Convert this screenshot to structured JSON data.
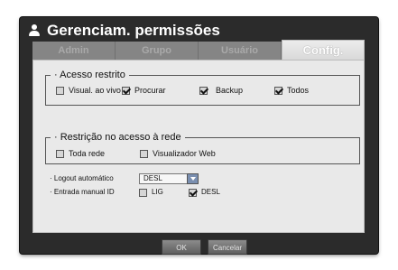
{
  "window": {
    "title": "Gerenciam. permissões"
  },
  "tabs": [
    {
      "label": "Admin",
      "active": false
    },
    {
      "label": "Grupo",
      "active": false
    },
    {
      "label": "Usuário",
      "active": false
    },
    {
      "label": "Config.",
      "active": true
    }
  ],
  "restricted_access": {
    "legend": "· Acesso restrito",
    "options": [
      {
        "label": "Visual. ao vivo",
        "checked": false
      },
      {
        "label": "Procurar",
        "checked": true
      },
      {
        "label": "Backup",
        "checked": true
      },
      {
        "label": "Todos",
        "checked": true
      }
    ]
  },
  "network_restriction": {
    "legend": "· Restrição no acesso à rede",
    "options": [
      {
        "label": "Toda rede",
        "checked": false
      },
      {
        "label": "Visualizador Web",
        "checked": false
      }
    ]
  },
  "auto_logout": {
    "label": "· Logout automático",
    "value": "DESL"
  },
  "manual_id": {
    "label": "· Entrada manual ID",
    "options": [
      {
        "label": "LIG",
        "checked": false
      },
      {
        "label": "DESL",
        "checked": true
      }
    ]
  },
  "buttons": {
    "ok": "OK",
    "cancel": "Cancelar"
  }
}
